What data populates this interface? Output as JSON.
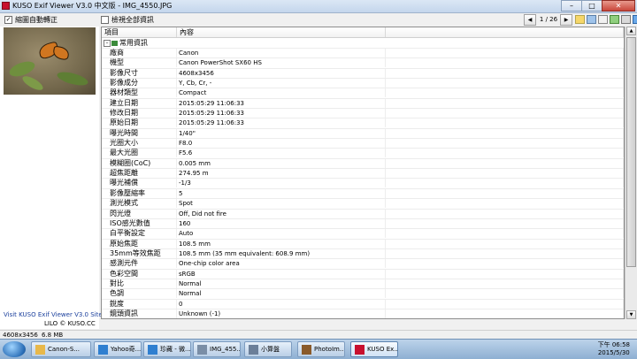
{
  "window": {
    "title": "KUSO Exif Viewer V3.0 中文版 - IMG_4550.JPG",
    "controls": {
      "minimize": "–",
      "maximize": "□",
      "close": "✕"
    }
  },
  "toolbar": {
    "auto_rotate_label": "縮圖自動轉正",
    "auto_rotate_checked": "✓",
    "show_all_label": "檢視全部資訊",
    "show_all_checked": "",
    "page_indicator": "1 / 26",
    "prev_symbol": "◀",
    "next_symbol": "▶"
  },
  "left_panel": {
    "site_text": "Visit KUSO Exif Viewer V3.0 Site",
    "credit_text": "LILO © KUSO.CC"
  },
  "table": {
    "headers": [
      "項目",
      "內容"
    ],
    "group_label": "常用資訊",
    "group_toggle": "–",
    "rows": [
      {
        "key": "廠商",
        "value": "Canon"
      },
      {
        "key": "機型",
        "value": "Canon PowerShot SX60 HS"
      },
      {
        "key": "影像尺寸",
        "value": "4608x3456"
      },
      {
        "key": "影像成分",
        "value": "Y, Cb, Cr, -"
      },
      {
        "key": "器材類型",
        "value": "Compact"
      },
      {
        "key": "建立日期",
        "value": "2015:05:29 11:06:33"
      },
      {
        "key": "修改日期",
        "value": "2015:05:29 11:06:33"
      },
      {
        "key": "原始日期",
        "value": "2015:05:29 11:06:33"
      },
      {
        "key": "曝光時間",
        "value": "1/40\""
      },
      {
        "key": "光圈大小",
        "value": "F8.0"
      },
      {
        "key": "最大光圈",
        "value": "F5.6"
      },
      {
        "key": "模糊圈(CoC)",
        "value": "0.005 mm"
      },
      {
        "key": "超焦距離",
        "value": "274.95 m"
      },
      {
        "key": "曝光補償",
        "value": "-1/3"
      },
      {
        "key": "影像壓縮率",
        "value": "5"
      },
      {
        "key": "測光模式",
        "value": "Spot"
      },
      {
        "key": "閃光燈",
        "value": "Off, Did not fire"
      },
      {
        "key": "ISO感光數值",
        "value": "160"
      },
      {
        "key": "白平衡設定",
        "value": "Auto"
      },
      {
        "key": "原始焦距",
        "value": "108.5 mm"
      },
      {
        "key": "35mm等效焦距",
        "value": "108.5 mm (35 mm equivalent: 608.9 mm)"
      },
      {
        "key": "感測元件",
        "value": "One-chip color area"
      },
      {
        "key": "色彩空間",
        "value": "sRGB"
      },
      {
        "key": "對比",
        "value": "Normal"
      },
      {
        "key": "色調",
        "value": "Normal"
      },
      {
        "key": "銳度",
        "value": "0"
      },
      {
        "key": "鏡頭資訊",
        "value": "Unknown (-1)"
      }
    ]
  },
  "status": {
    "dimensions": "4608x3456",
    "file_size": "6.8 MB"
  },
  "taskbar": {
    "items": [
      {
        "label": "Canon-S...",
        "icon": "folder-icon",
        "color": "#e8b84a"
      },
      {
        "label": "Yahoo奇...",
        "icon": "ie-icon",
        "color": "#2f7fd0"
      },
      {
        "label": "珍藏 - 微...",
        "icon": "ie-icon",
        "color": "#2f7fd0"
      },
      {
        "label": "IMG_455...",
        "icon": "image-icon",
        "color": "#7a8ea6"
      },
      {
        "label": "小算盤",
        "icon": "calculator-icon",
        "color": "#6b7f99"
      },
      {
        "label": "PhotoIm...",
        "icon": "photo-app-icon",
        "color": "#8a5a2a"
      },
      {
        "label": "KUSO Ex...",
        "icon": "kuso-icon",
        "color": "#c8102e"
      }
    ],
    "clock_time": "下午 06:58",
    "clock_date": "2015/5/30"
  }
}
